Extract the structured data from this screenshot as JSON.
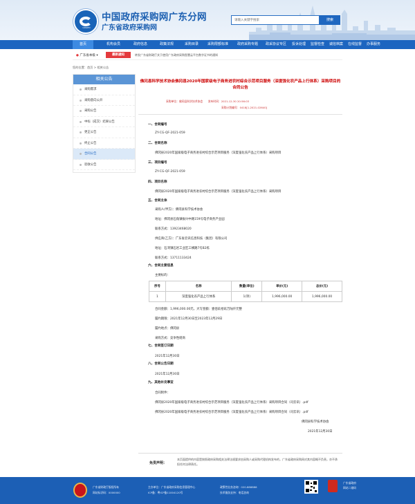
{
  "header": {
    "title": "中国政府采购网广东分网",
    "subtitle": "广东省政府采购网",
    "search_placeholder": "请输入关键字搜索",
    "search_button": "搜索",
    "logo_text": "GDGPO"
  },
  "nav": {
    "items": [
      "首页",
      "机构会员",
      "政府信息",
      "政策法规",
      "采购目录",
      "采购限额标准",
      "政府采购专题",
      "政采协议专区",
      "投诉处理",
      "监督检查",
      "诚信档案",
      "在线监督",
      "办事服务"
    ],
    "active_index": 0
  },
  "notice": {
    "location": "广东省本级",
    "badge": "最新通知",
    "text": "转发广东省财政厅关于使用广东政府采购智慧云平台数字证书的通知"
  },
  "breadcrumb": "您的位置：首页 > 相关公告",
  "sidebar": {
    "title": "相关公告",
    "items": [
      "采购需求",
      "采购意向公开",
      "采购公告",
      "中标（成交）结果公告",
      "更正公告",
      "终止公告",
      "合同公告",
      "验收公告"
    ],
    "active_index": 6
  },
  "article": {
    "title": "佛冈县科学技术协会佛冈县2020年国家级电子商务进农村综合示范项目服务（深度强化农产品上行体系）采购项目的合同公告",
    "meta1": "采购单位：佛冈县科学技术协会　　发布时间：2021-12-30 20:56:03",
    "meta2": "采购计划编号：0418[1-2021-02640]",
    "sections": [
      {
        "heading": "一、合同编号",
        "lines": [
          "ZY-CG-QF-2021-059"
        ]
      },
      {
        "heading": "二、合同名称",
        "lines": [
          "佛冈县2020年国家级电子商务进农村综合示范项目服务（深度强化农产品上行体系）采购项目"
        ]
      },
      {
        "heading": "三、项目编号",
        "lines": [
          "ZY-CG-QF-2021-059"
        ]
      },
      {
        "heading": "四、项目名称",
        "lines": [
          "佛冈县2020年国家级电子商务进农村综合示范项目服务（深度强化农产品上行体系）采购项目"
        ]
      },
      {
        "heading": "五、合同主体",
        "lines": [
          "采购人(甲方)：佛冈县科学技术协会",
          "地址：佛冈县石角镇振兴中路159号电子商务产业园",
          "联系方式：13923468020",
          "供应商(乙方)：广东省云讯信息科技（集团）有限公司",
          "地址：石湾镇石岩工业区三横路7号B2栋",
          "联系方式：13711133424"
        ]
      },
      {
        "heading": "六、合同主要信息",
        "lines": [
          "主要标的："
        ]
      }
    ],
    "table": {
      "headers": [
        "序号",
        "名称",
        "数量(单位)",
        "单价(元)",
        "总价(元)"
      ],
      "rows": [
        [
          "1",
          "深度强化农产品上行体系",
          "1(项)",
          "1,996,000.00",
          "1,996,000.00"
        ]
      ]
    },
    "contract_info": [
      "合同金额：1,996,000.00元，大写金额：壹佰玖拾玖万陆仟元整",
      "履约期限：2021年12月30日至2023年12月29日",
      "履约地点：佛冈县",
      "采购方式：竞争性磋商"
    ],
    "sections2": [
      {
        "heading": "七、合同签订日期",
        "lines": [
          "2021年12月30日"
        ]
      },
      {
        "heading": "八、合同公告日期",
        "lines": [
          "2021年12月30日"
        ]
      },
      {
        "heading": "九、其他补充事宜",
        "lines": [
          "合同附件：",
          "佛冈县2020年国家级电子商务进农村综合示范项目服务（深度强化农产品上行体系）采购项目合同（司云讯）.pdf",
          "佛冈县2020年国家级电子商务进农村综合示范项目服务（深度强化农产品上行体系）采购项目合同（司云讯）.pdf"
        ]
      }
    ],
    "signature_org": "佛冈县科学技术协会",
    "signature_date": "2021年12月30日"
  },
  "disclaimer": {
    "label": "免责声明：",
    "text": "本页面提供的内容是按照政府采购相关法律法规要求由采购人或采购代理机构发布的，广东省政府采购网对其内容概不负责，亦不承担任何法律责任。"
  },
  "footer": {
    "col1": [
      "广东省财政厅版权所有",
      "网站标识码：0000000"
    ],
    "col2": [
      "主办单位：广东省政府采购信息管理中心",
      "ICP备：粤ICP备11004120号"
    ],
    "col3": [
      "政策性业务咨询：020-888888",
      "技术服务支持：电话咨询"
    ],
    "badge_text": [
      "广东省政府",
      "网站二维码"
    ]
  },
  "colors": {
    "brand_blue": "#1c65c0",
    "title_red": "#cc0000",
    "badge_red": "#e4393c"
  }
}
